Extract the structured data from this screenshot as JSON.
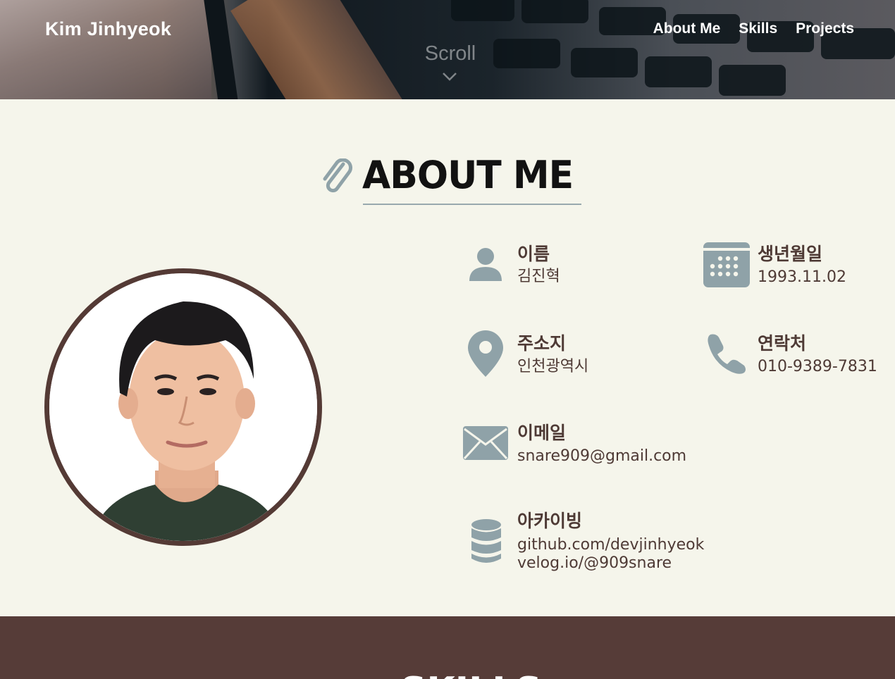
{
  "header": {
    "brand": "Kim Jinhyeok",
    "nav": [
      "About Me",
      "Skills",
      "Projects"
    ],
    "scroll_label": "Scroll"
  },
  "about": {
    "title": "ABOUT ME",
    "fields": {
      "name": {
        "label": "이름",
        "value": "김진혁"
      },
      "birth": {
        "label": "생년월일",
        "value": "1993.11.02"
      },
      "address": {
        "label": "주소지",
        "value": "인천광역시"
      },
      "phone": {
        "label": "연락처",
        "value": "010-9389-7831"
      },
      "email": {
        "label": "이메일",
        "value": "snare909@gmail.com"
      },
      "archive": {
        "label": "아카이빙",
        "values": [
          "github.com/devjinhyeok",
          "velog.io/@909snare"
        ]
      }
    }
  },
  "skills": {
    "title": "SKILLS"
  },
  "colors": {
    "background": "#f5f5eb",
    "text": "#4e3a35",
    "icon": "#8fa2a8",
    "skills_bg": "#563c38"
  }
}
